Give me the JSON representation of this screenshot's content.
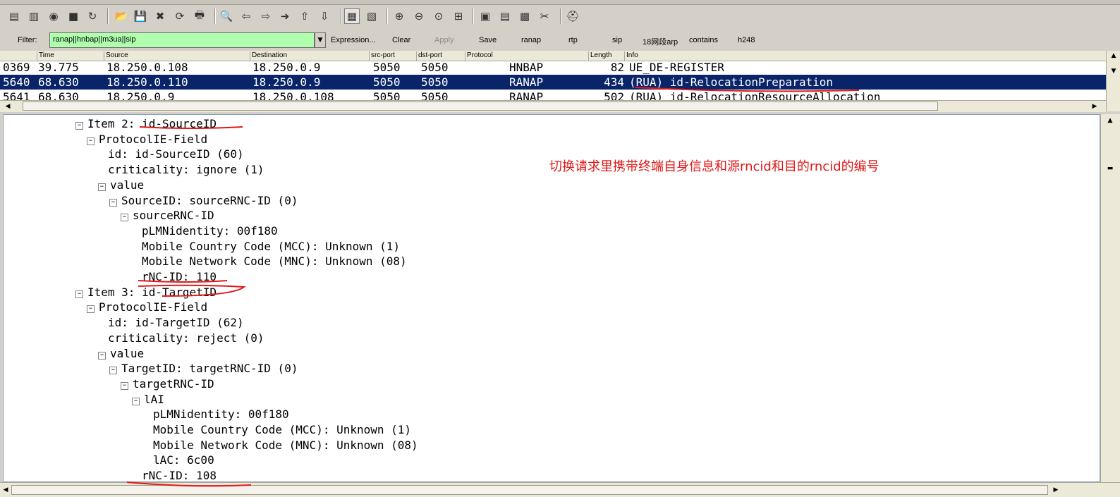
{
  "toolbar": {
    "icons": [
      "interface-list-icon",
      "capture-options-icon",
      "capture-start-icon",
      "capture-stop-icon",
      "capture-restart-icon",
      "open-file-icon",
      "save-file-icon",
      "close-file-icon",
      "reload-icon",
      "print-icon",
      "find-packet-icon",
      "go-back-icon",
      "go-forward-icon",
      "go-to-packet-icon",
      "go-first-icon",
      "go-last-icon",
      "colorize-icon",
      "auto-scroll-icon",
      "zoom-in-icon",
      "zoom-out-icon",
      "zoom-normal-icon",
      "resize-columns-icon",
      "capture-filters-icon",
      "display-filters-icon",
      "coloring-rules-icon",
      "preferences-icon",
      "help-icon"
    ]
  },
  "filter": {
    "label": "Filter:",
    "value": "ranap||hnbap||m3ua||sip",
    "buttons": [
      "Expression...",
      "Clear",
      "Apply",
      "Save",
      "ranap",
      "rtp",
      "sip",
      "18网段arp",
      "contains",
      "h248"
    ]
  },
  "packet_list": {
    "columns": [
      "Time",
      "Source",
      "Destination",
      "src-port",
      "dst-port",
      "Protocol",
      "Length",
      "Info"
    ],
    "rows": [
      {
        "no": "0369",
        "time": "39.775",
        "src": "18.250.0.108",
        "dst": "18.250.0.9",
        "sport": "5050",
        "dport": "5050",
        "proto": "HNBAP",
        "len": "82",
        "info": "UE_DE-REGISTER",
        "selected": false
      },
      {
        "no": "5640",
        "time": "68.630",
        "src": "18.250.0.110",
        "dst": "18.250.0.9",
        "sport": "5050",
        "dport": "5050",
        "proto": "RANAP",
        "len": "434",
        "info": "(RUA) id-RelocationPreparation",
        "selected": true
      },
      {
        "no": "5641",
        "time": "68.630",
        "src": "18.250.0.9",
        "dst": "18.250.0.108",
        "sport": "5050",
        "dport": "5050",
        "proto": "RANAP",
        "len": "502",
        "info": "(RUA) id-RelocationResourceAllocation",
        "selected": false
      }
    ]
  },
  "details": {
    "lines": [
      {
        "indent": 0,
        "exp": "⊟",
        "text": "Item 2: id-SourceID"
      },
      {
        "indent": 1,
        "exp": "⊟",
        "text": "ProtocolIE-Field"
      },
      {
        "indent": 2,
        "exp": "",
        "text": "id: id-SourceID (60)"
      },
      {
        "indent": 2,
        "exp": "",
        "text": "criticality: ignore (1)"
      },
      {
        "indent": 2,
        "exp": "⊟",
        "text": "value"
      },
      {
        "indent": 3,
        "exp": "⊟",
        "text": "SourceID: sourceRNC-ID (0)"
      },
      {
        "indent": 4,
        "exp": "⊟",
        "text": "sourceRNC-ID"
      },
      {
        "indent": 5,
        "exp": "",
        "text": "pLMNidentity: 00f180"
      },
      {
        "indent": 5,
        "exp": "",
        "text": "Mobile Country Code (MCC): Unknown (1)"
      },
      {
        "indent": 5,
        "exp": "",
        "text": "Mobile Network Code (MNC): Unknown (08)"
      },
      {
        "indent": 5,
        "exp": "",
        "text": "rNC-ID: 110"
      },
      {
        "indent": 0,
        "exp": "⊟",
        "text": "Item 3: id-TargetID"
      },
      {
        "indent": 1,
        "exp": "⊟",
        "text": "ProtocolIE-Field"
      },
      {
        "indent": 2,
        "exp": "",
        "text": "id: id-TargetID (62)"
      },
      {
        "indent": 2,
        "exp": "",
        "text": "criticality: reject (0)"
      },
      {
        "indent": 2,
        "exp": "⊟",
        "text": "value"
      },
      {
        "indent": 3,
        "exp": "⊟",
        "text": "TargetID: targetRNC-ID (0)"
      },
      {
        "indent": 4,
        "exp": "⊟",
        "text": "targetRNC-ID"
      },
      {
        "indent": 5,
        "exp": "⊟",
        "text": "lAI"
      },
      {
        "indent": 6,
        "exp": "",
        "text": "pLMNidentity: 00f180"
      },
      {
        "indent": 6,
        "exp": "",
        "text": "Mobile Country Code (MCC): Unknown (1)"
      },
      {
        "indent": 6,
        "exp": "",
        "text": "Mobile Network Code (MNC): Unknown (08)"
      },
      {
        "indent": 6,
        "exp": "",
        "text": "lAC: 6c00"
      },
      {
        "indent": 5,
        "exp": "",
        "text": "rNC-ID: 108"
      }
    ],
    "annotation": "切换请求里携带终端自身信息和源rncid和目的rncid的编号",
    "annotation_color": "#e01818"
  },
  "colors": {
    "selection": "#0a246a",
    "filter_ok": "#afffaf",
    "annotation_ink": "#e01818"
  }
}
